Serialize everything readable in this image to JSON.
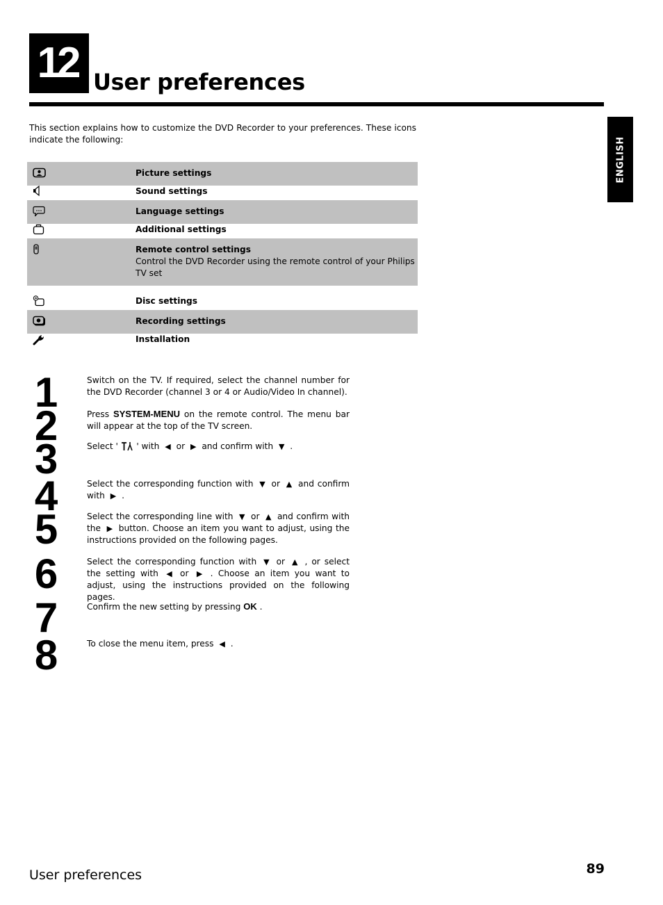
{
  "header": {
    "chapter_number": "12",
    "title": "User preferences",
    "language_tab": "ENGLISH"
  },
  "intro": "This section explains how to customize the DVD Recorder to your preferences. These icons indicate the following:",
  "icon_legend": [
    {
      "icon": "picture-icon",
      "name": "Picture settings",
      "description": ""
    },
    {
      "icon": "speaker-icon",
      "name": "Sound settings",
      "description": ""
    },
    {
      "icon": "speech-bubble-icon",
      "name": "Language settings",
      "description": ""
    },
    {
      "icon": "briefcase-icon",
      "name": "Additional settings",
      "description": ""
    },
    {
      "icon": "remote-control-icon",
      "name": "Remote control settings",
      "description": "Control the DVD Recorder using the remote control of your Philips TV set"
    },
    {
      "icon": "disc-case-icon",
      "name": "Disc settings",
      "description": ""
    },
    {
      "icon": "record-icon",
      "name": "Recording settings",
      "description": ""
    },
    {
      "icon": "wrench-icon",
      "name": "Installation",
      "description": ""
    }
  ],
  "steps": [
    {
      "number": "1",
      "parts": {
        "a": "Switch on the TV. If required, select the channel number for the DVD Recorder (channel 3 or 4 or Audio/Video In channel)."
      }
    },
    {
      "number": "2",
      "parts": {
        "a": "Press ",
        "key": "SYSTEM-MENU",
        "b": " on the remote control. The menu bar will appear at the top of the TV screen."
      }
    },
    {
      "number": "3",
      "parts": {
        "a": "Select '",
        "b": "' with ",
        "c": " or ",
        "d": " and confirm with ",
        "e": " ."
      }
    },
    {
      "number": "4",
      "parts": {
        "a": "Select the corresponding function with ",
        "b": " or ",
        "c": " and confirm with ",
        "d": " ."
      }
    },
    {
      "number": "5",
      "parts": {
        "a": "Select the corresponding line with ",
        "b": " or ",
        "c": " and confirm with the ",
        "d": " button. Choose an item you want to adjust, using the instructions provided on the following pages."
      }
    },
    {
      "number": "6",
      "parts": {
        "a": "Select the corresponding function with ",
        "b": " or ",
        "c": " , or select the setting with ",
        "d": " or ",
        "e": " . Choose an item you want to adjust, using the instructions provided on the following pages."
      }
    },
    {
      "number": "7",
      "parts": {
        "a": "Confirm the new setting by pressing ",
        "key": "OK",
        "b": " ."
      }
    },
    {
      "number": "8",
      "parts": {
        "a": "To close the menu item, press ",
        "b": " ."
      }
    }
  ],
  "glyphs": {
    "left": "◀",
    "right": "▶",
    "up": "▲",
    "down": "▼",
    "settings_symbol": "T̄⅄"
  },
  "footer": {
    "section_title": "User preferences",
    "page_number": "89"
  }
}
